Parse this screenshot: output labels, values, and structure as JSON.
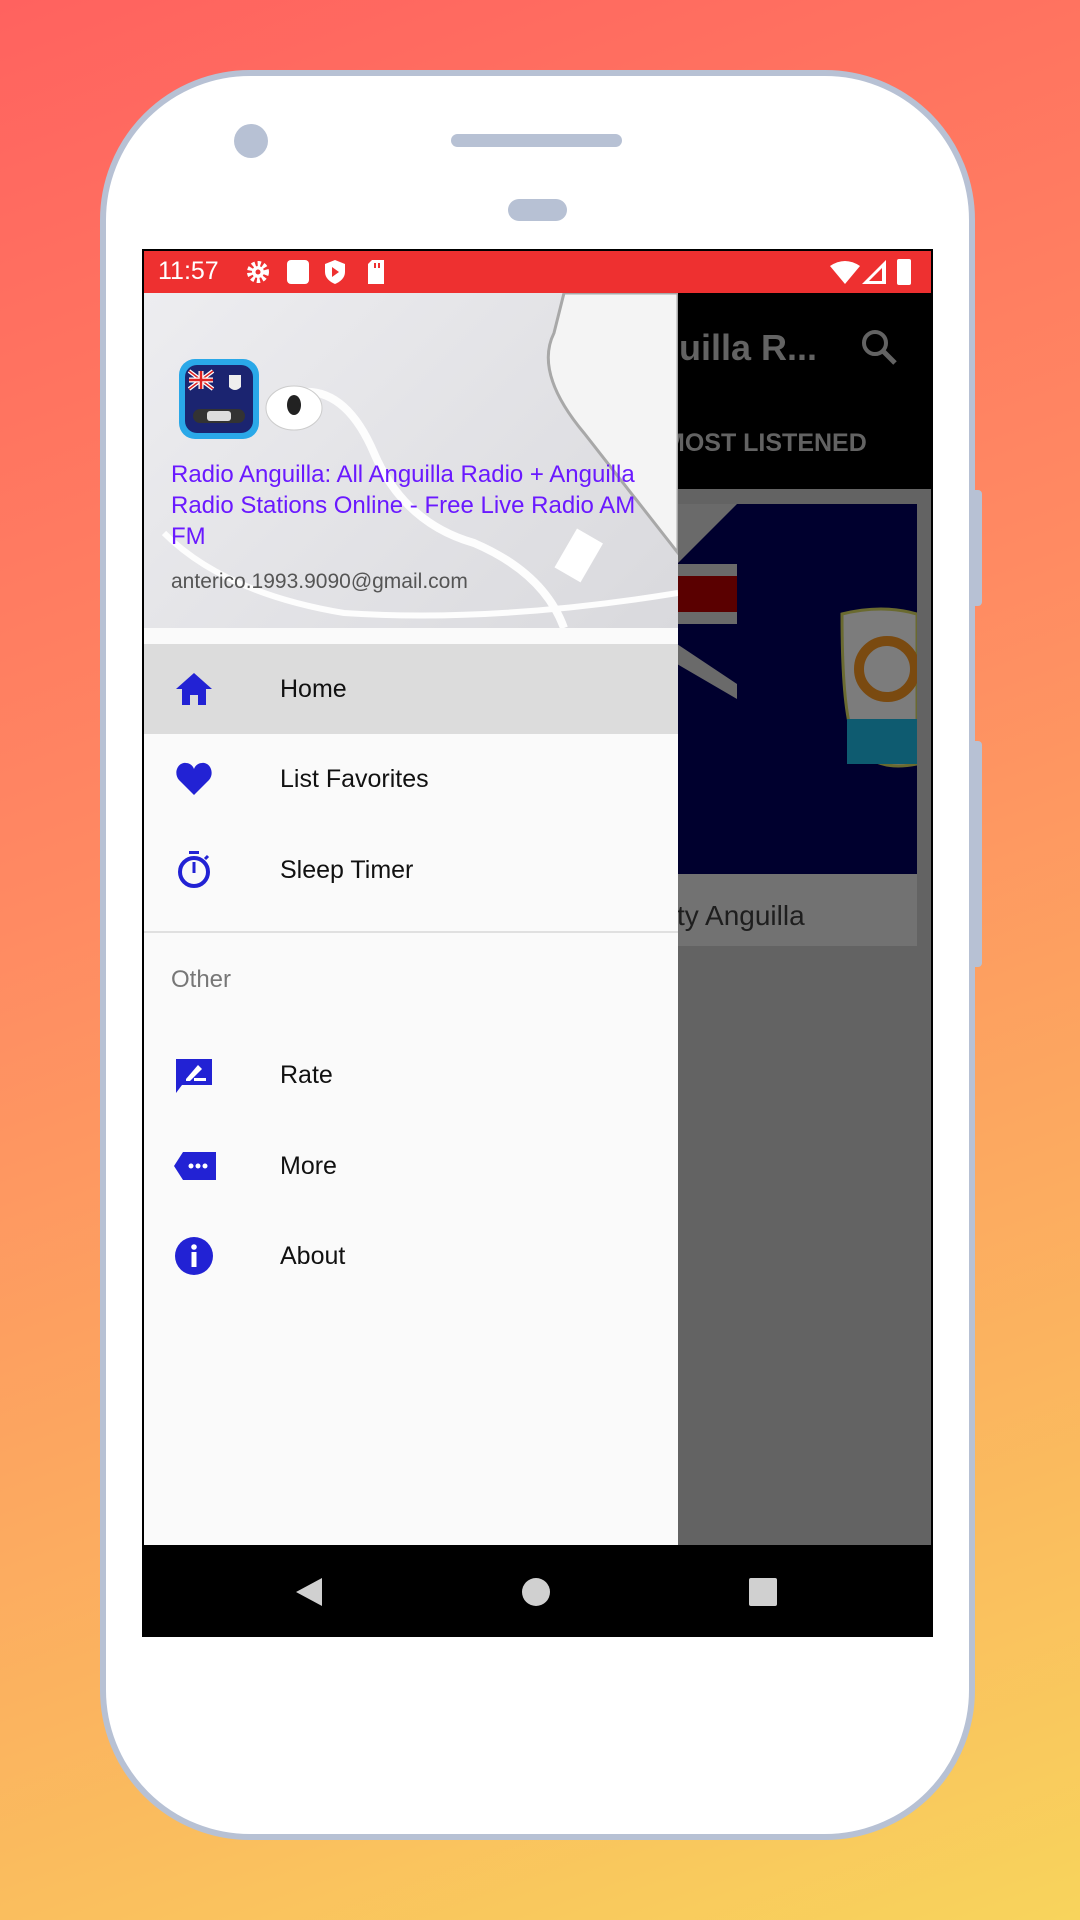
{
  "status_bar": {
    "time": "11:57",
    "icons": [
      "gear-icon",
      "square-icon",
      "play-shield-icon",
      "sd-card-icon",
      "wifi-icon",
      "signal-icon",
      "battery-icon"
    ],
    "color": "#ee3030"
  },
  "background_app": {
    "toolbar_title": "uilla R...",
    "tab": "MOST LISTENED",
    "card_text": "ty Anguilla",
    "icons": [
      "search-icon"
    ]
  },
  "drawer": {
    "header": {
      "title": "Radio Anguilla: All Anguilla Radio + Anguilla Radio Stations Online - Free Live Radio AM FM",
      "email": "anterico.1993.9090@gmail.com",
      "title_color": "#6a19ff"
    },
    "items": [
      {
        "label": "Home",
        "icon": "home-icon",
        "selected": true
      },
      {
        "label": "List Favorites",
        "icon": "heart-icon"
      },
      {
        "label": "Sleep Timer",
        "icon": "timer-icon"
      }
    ],
    "section_label": "Other",
    "other_items": [
      {
        "label": "Rate",
        "icon": "rate-review-icon"
      },
      {
        "label": "More",
        "icon": "more-label-icon"
      },
      {
        "label": "About",
        "icon": "info-icon"
      }
    ],
    "accent": "#2222d4"
  },
  "nav_bar": {
    "icons": [
      "back-icon",
      "home-circle-icon",
      "recents-icon"
    ]
  }
}
